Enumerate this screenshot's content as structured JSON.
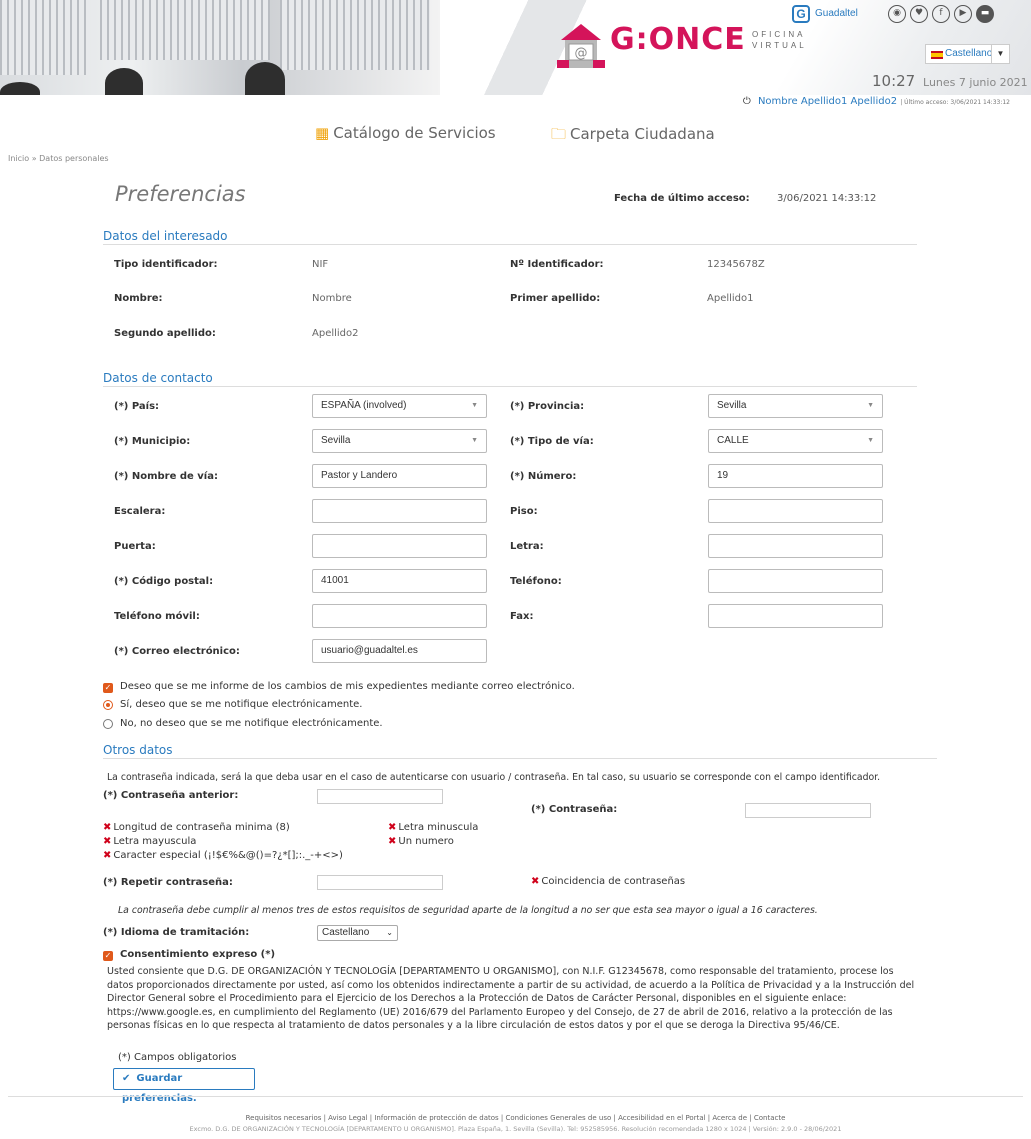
{
  "header": {
    "logo_text": "G:ONCE",
    "logo_sub": "OFICINA VIRTUAL",
    "partner_badge": "G",
    "partner_name": "Guadaltel",
    "social_icons": [
      "rss-icon",
      "twitter-icon",
      "facebook-icon",
      "youtube-icon",
      "print-icon"
    ],
    "language": "Castellano",
    "time": "10:27",
    "date": "Lunes 7 junio 2021",
    "user_name": "Nombre Apellido1 Apellido2",
    "user_last_access": "| Último acceso: 3/06/2021 14:33:12"
  },
  "nav": {
    "catalog": "Catálogo de Servicios",
    "folder": "Carpeta Ciudadana"
  },
  "breadcrumb": "Inicio » Datos personales",
  "page": {
    "title": "Preferencias",
    "last_access_label": "Fecha de último acceso:",
    "last_access_value": "3/06/2021 14:33:12"
  },
  "interesado": {
    "title": "Datos del interesado",
    "fields": [
      {
        "label": "Tipo identificador:",
        "value": "NIF"
      },
      {
        "label": "Nº Identificador:",
        "value": "12345678Z"
      },
      {
        "label": "Nombre:",
        "value": "Nombre"
      },
      {
        "label": "Primer apellido:",
        "value": "Apellido1"
      },
      {
        "label": "Segundo apellido:",
        "value": "Apellido2"
      }
    ]
  },
  "contacto": {
    "title": "Datos de contacto",
    "fields": [
      {
        "label": "(*) País:",
        "value": "ESPAÑA (involved)",
        "type": "select"
      },
      {
        "label": "(*) Provincia:",
        "value": "Sevilla",
        "type": "select"
      },
      {
        "label": "(*) Municipio:",
        "value": "Sevilla",
        "type": "select"
      },
      {
        "label": "(*) Tipo de vía:",
        "value": "CALLE",
        "type": "select"
      },
      {
        "label": "(*) Nombre de vía:",
        "value": "Pastor y Landero",
        "type": "text"
      },
      {
        "label": "(*) Número:",
        "value": "19",
        "type": "text"
      },
      {
        "label": "Escalera:",
        "value": "",
        "type": "text"
      },
      {
        "label": "Piso:",
        "value": "",
        "type": "text"
      },
      {
        "label": "Puerta:",
        "value": "",
        "type": "text"
      },
      {
        "label": "Letra:",
        "value": "",
        "type": "text"
      },
      {
        "label": "(*) Código postal:",
        "value": "41001",
        "type": "text"
      },
      {
        "label": "Teléfono:",
        "value": "",
        "type": "text"
      },
      {
        "label": "Teléfono móvil:",
        "value": "",
        "type": "text"
      },
      {
        "label": "Fax:",
        "value": "",
        "type": "text"
      },
      {
        "label": "(*) Correo electrónico:",
        "value": "usuario@guadaltel.es",
        "type": "text"
      }
    ]
  },
  "notify": {
    "checkbox_label": "Deseo que se me informe de los cambios de mis expedientes mediante correo electrónico.",
    "checkbox_checked": true,
    "radio_yes": "Sí, deseo que se me notifique electrónicamente.",
    "radio_no": "No, no deseo que se me notifique electrónicamente.",
    "selected": "yes"
  },
  "otros": {
    "title": "Otros datos",
    "info": "La contraseña indicada, será la que deba usar en el caso de autenticarse con usuario / contraseña. En tal caso, su usuario se corresponde con el campo identificador.",
    "old_password_label": "(*) Contraseña anterior:",
    "password_label": "(*) Contraseña:",
    "repeat_label": "(*) Repetir contraseña:",
    "requirements": [
      "Longitud de contraseña minima (8)",
      "Letra minuscula",
      "Letra mayuscula",
      "Un numero",
      "Caracter especial (¡!$€%&@()=?¿*[];:._-+<>)"
    ],
    "match_requirement": "Coincidencia de contraseñas",
    "policy_note": "La contraseña debe cumplir al menos tres de estos requisitos de seguridad aparte de la longitud a no ser que esta sea mayor o igual a 16 caracteres.",
    "language_label": "(*) Idioma de tramitación:",
    "language_value": "Castellano",
    "consent_label": "Consentimiento expreso (*)",
    "consent_checked": true,
    "legal_text": "Usted consiente que D.G. DE ORGANIZACIÓN Y TECNOLOGÍA [DEPARTAMENTO U ORGANISMO], con N.I.F. G12345678, como responsable del tratamiento, procese los datos proporcionados directamente por usted, así como los obtenidos indirectamente a partir de su actividad, de acuerdo a la Política de Privacidad y a la Instrucción del Director General sobre el Procedimiento para el Ejercicio de los Derechos a la Protección de Datos de Carácter Personal, disponibles en el siguiente enlace: https://www.google.es, en cumplimiento del Reglamento (UE) 2016/679 del Parlamento Europeo y del Consejo, de 27 de abril de 2016, relativo a la protección de las personas físicas en lo que respecta al tratamiento de datos personales y a la libre circulación de estos datos y por el que se deroga la Directiva 95/46/CE.",
    "required_note": "(*) Campos obligatorios",
    "save_label": "Guardar preferencias."
  },
  "footer": {
    "links": "Requisitos necesarios | Aviso Legal | Información de protección de datos | Condiciones Generales de uso | Accesibilidad en el Portal | Acerca de | Contacte",
    "address": "Excmo. D.G. DE ORGANIZACIÓN Y TECNOLOGÍA [DEPARTAMENTO U ORGANISMO]. Plaza España, 1. Sevilla (Sevilla). Tel: 952585956. Resolución recomendada 1280 x 1024 | Versión: 2.9.0 - 28/06/2021"
  },
  "colors": {
    "accent": "#2a7bbf",
    "brand": "#d4145a",
    "check": "#e0591b",
    "error": "#d0021b"
  }
}
